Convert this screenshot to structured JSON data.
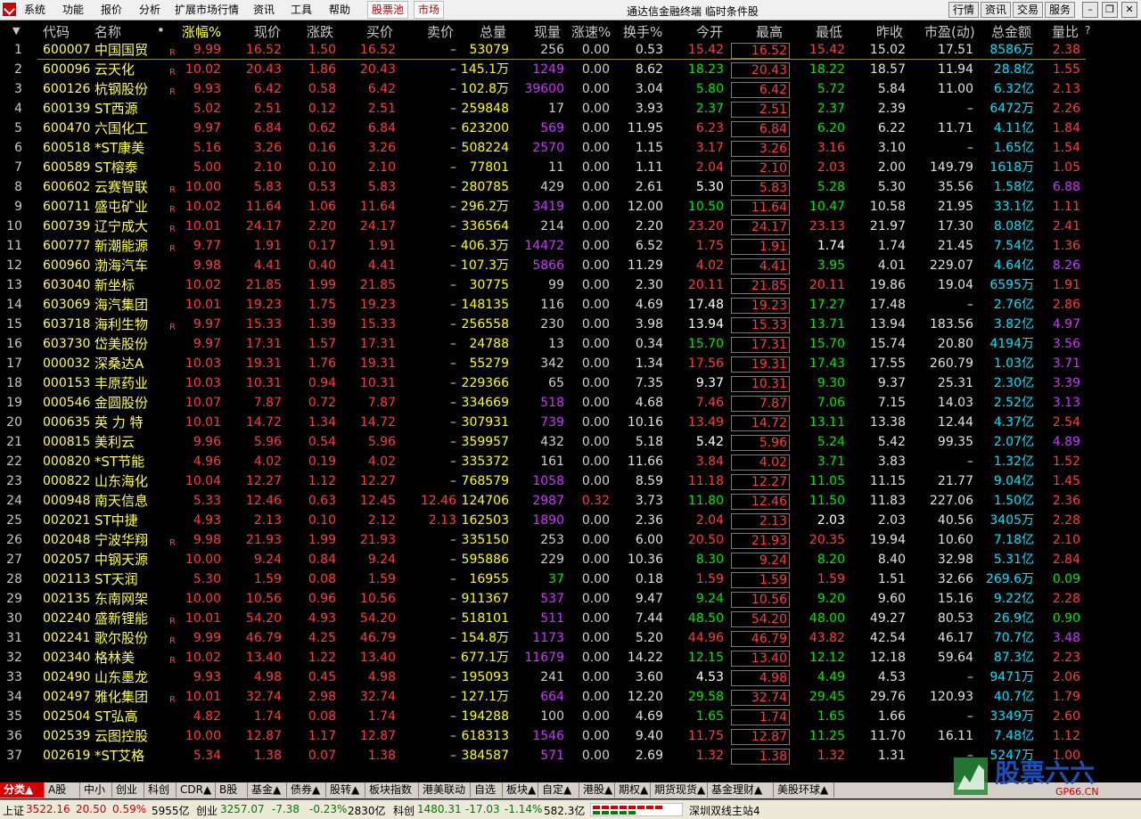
{
  "titlebar": {
    "menus": [
      "系统",
      "功能",
      "报价",
      "分析",
      "扩展市场行情",
      "资讯",
      "工具",
      "帮助"
    ],
    "boxed": [
      "股票池",
      "市场"
    ],
    "title": "通达信金融终端  临时条件股",
    "buttons": [
      "行情",
      "资讯",
      "交易",
      "服务"
    ]
  },
  "header": {
    "sort_arrow": "▼",
    "cols": [
      "代码",
      "名称",
      "•",
      "涨幅%",
      "现价",
      "涨跌",
      "买价",
      "卖价",
      "总量",
      "现量",
      "涨速%",
      "换手%",
      "今开",
      "最高",
      "最低",
      "昨收",
      "市盈(动)",
      "总金额",
      "量比",
      "?"
    ]
  },
  "rows": [
    [
      "1",
      "600007",
      "中国国贸",
      "R",
      "9.99",
      "16.52",
      "1.50",
      "16.52",
      "–",
      "53079",
      "256",
      "0.00",
      "0.53",
      "15.42",
      "16.52",
      "15.42",
      "15.02",
      "17.51",
      "8586万",
      "2.38"
    ],
    [
      "2",
      "600096",
      "云天化",
      "R",
      "10.02",
      "20.43",
      "1.86",
      "20.43",
      "–",
      "145.1万",
      "1249",
      "0.00",
      "8.62",
      "18.23",
      "20.43",
      "18.22",
      "18.57",
      "11.94",
      "28.8亿",
      "1.55"
    ],
    [
      "3",
      "600126",
      "杭钢股份",
      "R",
      "9.93",
      "6.42",
      "0.58",
      "6.42",
      "–",
      "102.8万",
      "39600",
      "0.00",
      "3.04",
      "5.80",
      "6.42",
      "5.72",
      "5.84",
      "11.00",
      "6.32亿",
      "2.13"
    ],
    [
      "4",
      "600139",
      "ST西源",
      "",
      "5.02",
      "2.51",
      "0.12",
      "2.51",
      "–",
      "259848",
      "17",
      "0.00",
      "3.93",
      "2.37",
      "2.51",
      "2.37",
      "2.39",
      "–",
      "6472万",
      "2.26"
    ],
    [
      "5",
      "600470",
      "六国化工",
      "",
      "9.97",
      "6.84",
      "0.62",
      "6.84",
      "–",
      "623200",
      "569",
      "0.00",
      "11.95",
      "6.23",
      "6.84",
      "6.20",
      "6.22",
      "11.71",
      "4.11亿",
      "1.84"
    ],
    [
      "6",
      "600518",
      "*ST康美",
      "",
      "5.16",
      "3.26",
      "0.16",
      "3.26",
      "–",
      "508224",
      "2570",
      "0.00",
      "1.15",
      "3.17",
      "3.26",
      "3.16",
      "3.10",
      "–",
      "1.65亿",
      "1.54"
    ],
    [
      "7",
      "600589",
      "ST榕泰",
      "",
      "5.00",
      "2.10",
      "0.10",
      "2.10",
      "–",
      "77801",
      "11",
      "0.00",
      "1.11",
      "2.04",
      "2.10",
      "2.03",
      "2.00",
      "149.79",
      "1618万",
      "1.05"
    ],
    [
      "8",
      "600602",
      "云赛智联",
      "R",
      "10.00",
      "5.83",
      "0.53",
      "5.83",
      "–",
      "280785",
      "429",
      "0.00",
      "2.61",
      "5.30",
      "5.83",
      "5.28",
      "5.30",
      "35.56",
      "1.58亿",
      "6.88"
    ],
    [
      "9",
      "600711",
      "盛屯矿业",
      "R",
      "10.02",
      "11.64",
      "1.06",
      "11.64",
      "–",
      "296.2万",
      "3419",
      "0.00",
      "12.00",
      "10.50",
      "11.64",
      "10.47",
      "10.58",
      "21.95",
      "33.1亿",
      "1.11"
    ],
    [
      "10",
      "600739",
      "辽宁成大",
      "R",
      "10.01",
      "24.17",
      "2.20",
      "24.17",
      "–",
      "336564",
      "214",
      "0.00",
      "2.20",
      "23.20",
      "24.17",
      "23.13",
      "21.97",
      "17.30",
      "8.08亿",
      "2.41"
    ],
    [
      "11",
      "600777",
      "新潮能源",
      "R",
      "9.77",
      "1.91",
      "0.17",
      "1.91",
      "–",
      "406.3万",
      "14472",
      "0.00",
      "6.52",
      "1.75",
      "1.91",
      "1.74",
      "1.74",
      "21.45",
      "7.54亿",
      "1.36"
    ],
    [
      "12",
      "600960",
      "渤海汽车",
      "",
      "9.98",
      "4.41",
      "0.40",
      "4.41",
      "–",
      "107.3万",
      "5866",
      "0.00",
      "11.29",
      "4.02",
      "4.41",
      "3.95",
      "4.01",
      "229.07",
      "4.64亿",
      "8.26"
    ],
    [
      "13",
      "603040",
      "新坐标",
      "",
      "10.02",
      "21.85",
      "1.99",
      "21.85",
      "–",
      "30775",
      "99",
      "0.00",
      "2.30",
      "20.11",
      "21.85",
      "20.11",
      "19.86",
      "19.04",
      "6595万",
      "1.91"
    ],
    [
      "14",
      "603069",
      "海汽集团",
      "",
      "10.01",
      "19.23",
      "1.75",
      "19.23",
      "–",
      "148135",
      "116",
      "0.00",
      "4.69",
      "17.48",
      "19.23",
      "17.27",
      "17.48",
      "–",
      "2.76亿",
      "2.86"
    ],
    [
      "15",
      "603718",
      "海利生物",
      "R",
      "9.97",
      "15.33",
      "1.39",
      "15.33",
      "–",
      "256558",
      "230",
      "0.00",
      "3.98",
      "13.94",
      "15.33",
      "13.71",
      "13.94",
      "183.56",
      "3.82亿",
      "4.97"
    ],
    [
      "16",
      "603730",
      "岱美股份",
      "",
      "9.97",
      "17.31",
      "1.57",
      "17.31",
      "–",
      "24788",
      "13",
      "0.00",
      "0.34",
      "15.70",
      "17.31",
      "15.70",
      "15.74",
      "20.80",
      "4194万",
      "3.56"
    ],
    [
      "17",
      "000032",
      "深桑达A",
      "",
      "10.03",
      "19.31",
      "1.76",
      "19.31",
      "–",
      "55279",
      "342",
      "0.00",
      "1.34",
      "17.56",
      "19.31",
      "17.43",
      "17.55",
      "260.79",
      "1.03亿",
      "3.71"
    ],
    [
      "18",
      "000153",
      "丰原药业",
      "",
      "10.03",
      "10.31",
      "0.94",
      "10.31",
      "–",
      "229366",
      "65",
      "0.00",
      "7.35",
      "9.37",
      "10.31",
      "9.30",
      "9.37",
      "25.31",
      "2.30亿",
      "3.39"
    ],
    [
      "19",
      "000546",
      "金圆股份",
      "",
      "10.07",
      "7.87",
      "0.72",
      "7.87",
      "–",
      "334669",
      "518",
      "0.00",
      "4.68",
      "7.46",
      "7.87",
      "7.06",
      "7.15",
      "14.03",
      "2.52亿",
      "3.13"
    ],
    [
      "20",
      "000635",
      "英 力 特",
      "",
      "10.01",
      "14.72",
      "1.34",
      "14.72",
      "–",
      "307931",
      "739",
      "0.00",
      "10.16",
      "13.49",
      "14.72",
      "13.11",
      "13.38",
      "12.44",
      "4.37亿",
      "2.54"
    ],
    [
      "21",
      "000815",
      "美利云",
      "",
      "9.96",
      "5.96",
      "0.54",
      "5.96",
      "–",
      "359957",
      "432",
      "0.00",
      "5.18",
      "5.42",
      "5.96",
      "5.24",
      "5.42",
      "99.35",
      "2.07亿",
      "4.89"
    ],
    [
      "22",
      "000820",
      "*ST节能",
      "",
      "4.96",
      "4.02",
      "0.19",
      "4.02",
      "–",
      "335372",
      "161",
      "0.00",
      "11.66",
      "3.84",
      "4.02",
      "3.71",
      "3.83",
      "–",
      "1.32亿",
      "1.52"
    ],
    [
      "23",
      "000822",
      "山东海化",
      "",
      "10.04",
      "12.27",
      "1.12",
      "12.27",
      "–",
      "768579",
      "1058",
      "0.00",
      "8.59",
      "11.18",
      "12.27",
      "11.05",
      "11.15",
      "21.77",
      "9.04亿",
      "1.45"
    ],
    [
      "24",
      "000948",
      "南天信息",
      "",
      "5.33",
      "12.46",
      "0.63",
      "12.45",
      "12.46",
      "124706",
      "2987",
      "0.32",
      "3.73",
      "11.80",
      "12.46",
      "11.50",
      "11.83",
      "227.06",
      "1.50亿",
      "2.36"
    ],
    [
      "25",
      "002021",
      "ST中捷",
      "",
      "4.93",
      "2.13",
      "0.10",
      "2.12",
      "2.13",
      "162503",
      "1890",
      "0.00",
      "2.36",
      "2.04",
      "2.13",
      "2.03",
      "2.03",
      "40.56",
      "3405万",
      "2.28"
    ],
    [
      "26",
      "002048",
      "宁波华翔",
      "R",
      "9.98",
      "21.93",
      "1.99",
      "21.93",
      "–",
      "335150",
      "253",
      "0.00",
      "6.00",
      "20.50",
      "21.93",
      "20.35",
      "19.94",
      "10.60",
      "7.18亿",
      "2.10"
    ],
    [
      "27",
      "002057",
      "中钢天源",
      "",
      "10.00",
      "9.24",
      "0.84",
      "9.24",
      "–",
      "595886",
      "229",
      "0.00",
      "10.36",
      "8.30",
      "9.24",
      "8.20",
      "8.40",
      "32.98",
      "5.31亿",
      "2.84"
    ],
    [
      "28",
      "002113",
      "ST天润",
      "",
      "5.30",
      "1.59",
      "0.08",
      "1.59",
      "–",
      "16955",
      "37",
      "0.00",
      "0.18",
      "1.59",
      "1.59",
      "1.59",
      "1.51",
      "32.66",
      "269.6万",
      "0.09"
    ],
    [
      "29",
      "002135",
      "东南网架",
      "",
      "10.00",
      "10.56",
      "0.96",
      "10.56",
      "–",
      "911367",
      "537",
      "0.00",
      "9.47",
      "9.24",
      "10.56",
      "9.20",
      "9.60",
      "15.16",
      "9.22亿",
      "2.28"
    ],
    [
      "30",
      "002240",
      "盛新锂能",
      "R",
      "10.01",
      "54.20",
      "4.93",
      "54.20",
      "–",
      "518101",
      "511",
      "0.00",
      "7.44",
      "48.50",
      "54.20",
      "48.00",
      "49.27",
      "80.53",
      "26.9亿",
      "0.90"
    ],
    [
      "31",
      "002241",
      "歌尔股份",
      "R",
      "9.99",
      "46.79",
      "4.25",
      "46.79",
      "–",
      "154.8万",
      "1173",
      "0.00",
      "5.20",
      "44.96",
      "46.79",
      "43.82",
      "42.54",
      "46.17",
      "70.7亿",
      "3.48"
    ],
    [
      "32",
      "002340",
      "格林美",
      "R",
      "10.02",
      "13.40",
      "1.22",
      "13.40",
      "–",
      "677.1万",
      "11679",
      "0.00",
      "14.22",
      "12.15",
      "13.40",
      "12.12",
      "12.18",
      "59.64",
      "87.3亿",
      "2.23"
    ],
    [
      "33",
      "002490",
      "山东墨龙",
      "",
      "9.93",
      "4.98",
      "0.45",
      "4.98",
      "–",
      "195093",
      "241",
      "0.00",
      "3.60",
      "4.53",
      "4.98",
      "4.49",
      "4.53",
      "–",
      "9471万",
      "2.06"
    ],
    [
      "34",
      "002497",
      "雅化集团",
      "R",
      "10.01",
      "32.74",
      "2.98",
      "32.74",
      "–",
      "127.1万",
      "664",
      "0.00",
      "12.20",
      "29.58",
      "32.74",
      "29.45",
      "29.76",
      "120.93",
      "40.7亿",
      "1.79"
    ],
    [
      "35",
      "002504",
      "ST弘高",
      "",
      "4.82",
      "1.74",
      "0.08",
      "1.74",
      "–",
      "194288",
      "100",
      "0.00",
      "4.69",
      "1.65",
      "1.74",
      "1.65",
      "1.66",
      "–",
      "3349万",
      "2.60"
    ],
    [
      "36",
      "002539",
      "云图控股",
      "",
      "10.00",
      "12.87",
      "1.17",
      "12.87",
      "–",
      "618313",
      "1546",
      "0.00",
      "9.40",
      "11.75",
      "12.87",
      "11.25",
      "11.70",
      "16.11",
      "7.48亿",
      "1.12"
    ],
    [
      "37",
      "002619",
      "*ST艾格",
      "",
      "5.34",
      "1.38",
      "0.07",
      "1.38",
      "–",
      "384587",
      "571",
      "0.00",
      "2.69",
      "1.32",
      "1.38",
      "1.32",
      "1.31",
      "–",
      "5247万",
      "1.00"
    ]
  ],
  "tabs": [
    "分类▲",
    "A股",
    "中小",
    "创业",
    "科创",
    "CDR▲",
    "B股",
    "基金▲",
    "债券▲",
    "股转▲",
    "板块指数",
    "港美联动",
    "自选",
    "板块▲",
    "自定▲",
    "港股▲",
    "期权▲",
    "期货现货▲",
    "基金理财▲",
    "美股环球▲"
  ],
  "status": {
    "sh_label": "上证",
    "sh_val": "3522.16",
    "sh_chg": "20.50",
    "sh_pct": "0.59%",
    "sh_amt": "5955亿",
    "cy_label": "创业",
    "cy_val": "3257.07",
    "cy_chg": "-7.38",
    "cy_pct": "-0.23%",
    "cy_amt": "2830亿",
    "kc_label": "科创",
    "kc_val": "1480.31",
    "kc_chg": "-17.03",
    "kc_pct": "-1.14%",
    "kc_amt": "582.3亿",
    "server": "深圳双线主站4"
  },
  "watermark": {
    "brand": "股票六六",
    "domain": "GP66.CN"
  }
}
